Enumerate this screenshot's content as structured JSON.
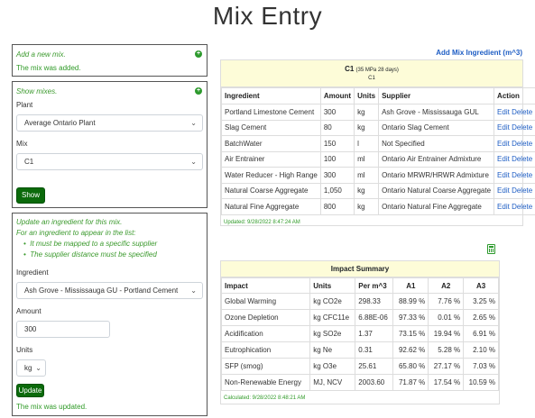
{
  "page": {
    "title": "Mix Entry"
  },
  "add_panel": {
    "heading": "Add a new mix.",
    "message": "The mix was added."
  },
  "show_panel": {
    "heading": "Show mixes.",
    "plant_label": "Plant",
    "plant_value": "Average Ontario Plant",
    "mix_label": "Mix",
    "mix_value": "C1",
    "show_button": "Show"
  },
  "update_panel": {
    "heading": "Update an ingredient for this mix.",
    "note": "For an ingredient to appear in the list:",
    "bullets": [
      "It must be mapped to a specific supplier",
      "The supplier distance must be specified"
    ],
    "ingredient_label": "Ingredient",
    "ingredient_value": "Ash Grove - Mississauga GU - Portland Cement",
    "amount_label": "Amount",
    "amount_value": "300",
    "units_label": "Units",
    "units_value": "kg",
    "update_button": "Update",
    "message": "The mix was updated."
  },
  "mix_table": {
    "add_link": "Add Mix Ingredient (m^3)",
    "mix_name": "C1",
    "mix_desc": "(35 MPa 28 days)",
    "mix_sub": "C1",
    "headers": [
      "Ingredient",
      "Amount",
      "Units",
      "Supplier",
      "Action"
    ],
    "rows": [
      [
        "Portland Limestone Cement",
        "300",
        "kg",
        "Ash Grove - Mississauga GUL"
      ],
      [
        "Slag Cement",
        "80",
        "kg",
        "Ontario Slag Cement"
      ],
      [
        "BatchWater",
        "150",
        "l",
        "Not Specified"
      ],
      [
        "Air Entrainer",
        "100",
        "ml",
        "Ontario Air Entrainer Admixture"
      ],
      [
        "Water Reducer - High Range",
        "300",
        "ml",
        "Ontario MRWR/HRWR Admixture"
      ],
      [
        "Natural Coarse Aggregate",
        "1,050",
        "kg",
        "Ontario Natural Coarse Aggregate"
      ],
      [
        "Natural Fine Aggregate",
        "800",
        "kg",
        "Ontario Natural Fine Aggregate"
      ]
    ],
    "edit_label": "Edit",
    "delete_label": "Delete",
    "updated": "Updated: 9/28/2022 8:47:24 AM"
  },
  "impact_table": {
    "title": "Impact Summary",
    "headers": [
      "Impact",
      "Units",
      "Per m^3",
      "A1",
      "A2",
      "A3"
    ],
    "rows": [
      [
        "Global Warming",
        "kg CO2e",
        "298.33",
        "88.99 %",
        "7.76 %",
        "3.25 %"
      ],
      [
        "Ozone Depletion",
        "kg CFC11e",
        "6.88E-06",
        "97.33 %",
        "0.01 %",
        "2.65 %"
      ],
      [
        "Acidification",
        "kg SO2e",
        "1.37",
        "73.15 %",
        "19.94 %",
        "6.91 %"
      ],
      [
        "Eutrophication",
        "kg Ne",
        "0.31",
        "92.62 %",
        "5.28 %",
        "2.10 %"
      ],
      [
        "SFP (smog)",
        "kg O3e",
        "25.61",
        "65.80 %",
        "27.17 %",
        "7.03 %"
      ],
      [
        "Non-Renewable Energy",
        "MJ, NCV",
        "2003.60",
        "71.87 %",
        "17.54 %",
        "10.59 %"
      ]
    ],
    "calculated": "Calculated: 9/28/2022 8:48:21 AM"
  },
  "colors": {
    "accent_green": "#0b6a0b",
    "link_blue": "#1f5ec4",
    "header_yellow": "#fdfcd8",
    "message_green": "#2f9a27"
  },
  "icons": {
    "add_mix": "plus-circle-icon",
    "show_mix": "plus-circle-icon",
    "calculator": "calculator-icon"
  }
}
